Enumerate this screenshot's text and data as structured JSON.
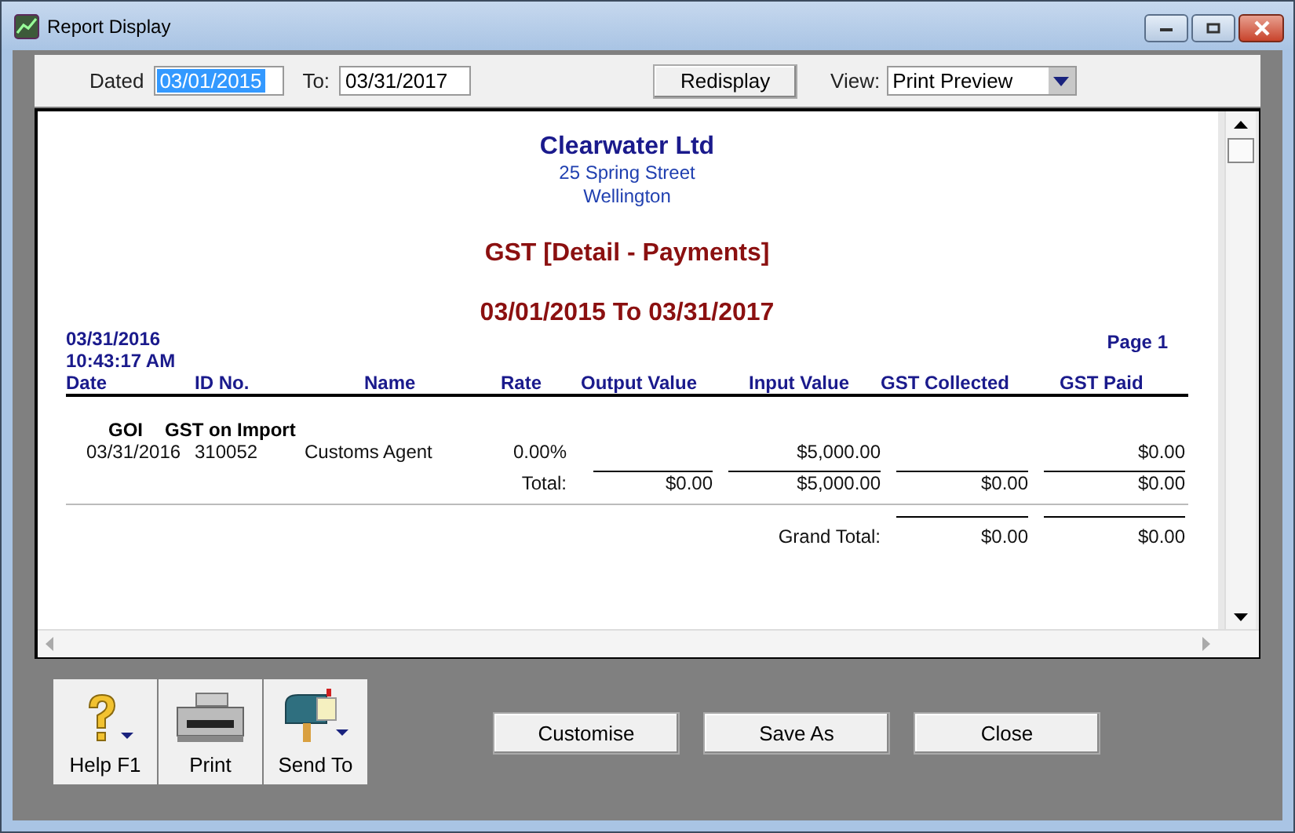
{
  "window": {
    "title": "Report Display"
  },
  "toolbar": {
    "dated_label": "Dated",
    "dated_value": "03/01/2015",
    "dated_selected": true,
    "to_label": "To:",
    "to_value": "03/31/2017",
    "redisplay": "Redisplay",
    "view_label": "View:",
    "view_value": "Print Preview"
  },
  "report": {
    "company": "Clearwater Ltd",
    "address": [
      "25 Spring Street",
      "Wellington"
    ],
    "title": "GST [Detail - Payments]",
    "period": "03/01/2015 To 03/31/2017",
    "printed_date": "03/31/2016",
    "printed_time": "10:43:17 AM",
    "page": "Page 1",
    "columns": [
      "Date",
      "ID No.",
      "Name",
      "Rate",
      "Output Value",
      "Input Value",
      "GST Collected",
      "GST Paid"
    ],
    "groups": [
      {
        "code": "GOI",
        "name": "GST on Import",
        "rows": [
          {
            "date": "03/31/2016",
            "id_no": "310052",
            "name": "Customs Agent",
            "rate": "0.00%",
            "input_value": "$5,000.00",
            "gst_paid": "$0.00"
          }
        ],
        "total_label": "Total:",
        "totals": {
          "output_value": "$0.00",
          "input_value": "$5,000.00",
          "gst_collected": "$0.00",
          "gst_paid": "$0.00"
        }
      }
    ],
    "grand_total": {
      "label": "Grand Total:",
      "gst_collected": "$0.00",
      "gst_paid": "$0.00"
    }
  },
  "tools": [
    {
      "kind": "help",
      "label": "Help F1"
    },
    {
      "kind": "print",
      "label": "Print"
    },
    {
      "kind": "send",
      "label": "Send To"
    }
  ],
  "buttons": [
    "Customise",
    "Save As",
    "Close"
  ]
}
